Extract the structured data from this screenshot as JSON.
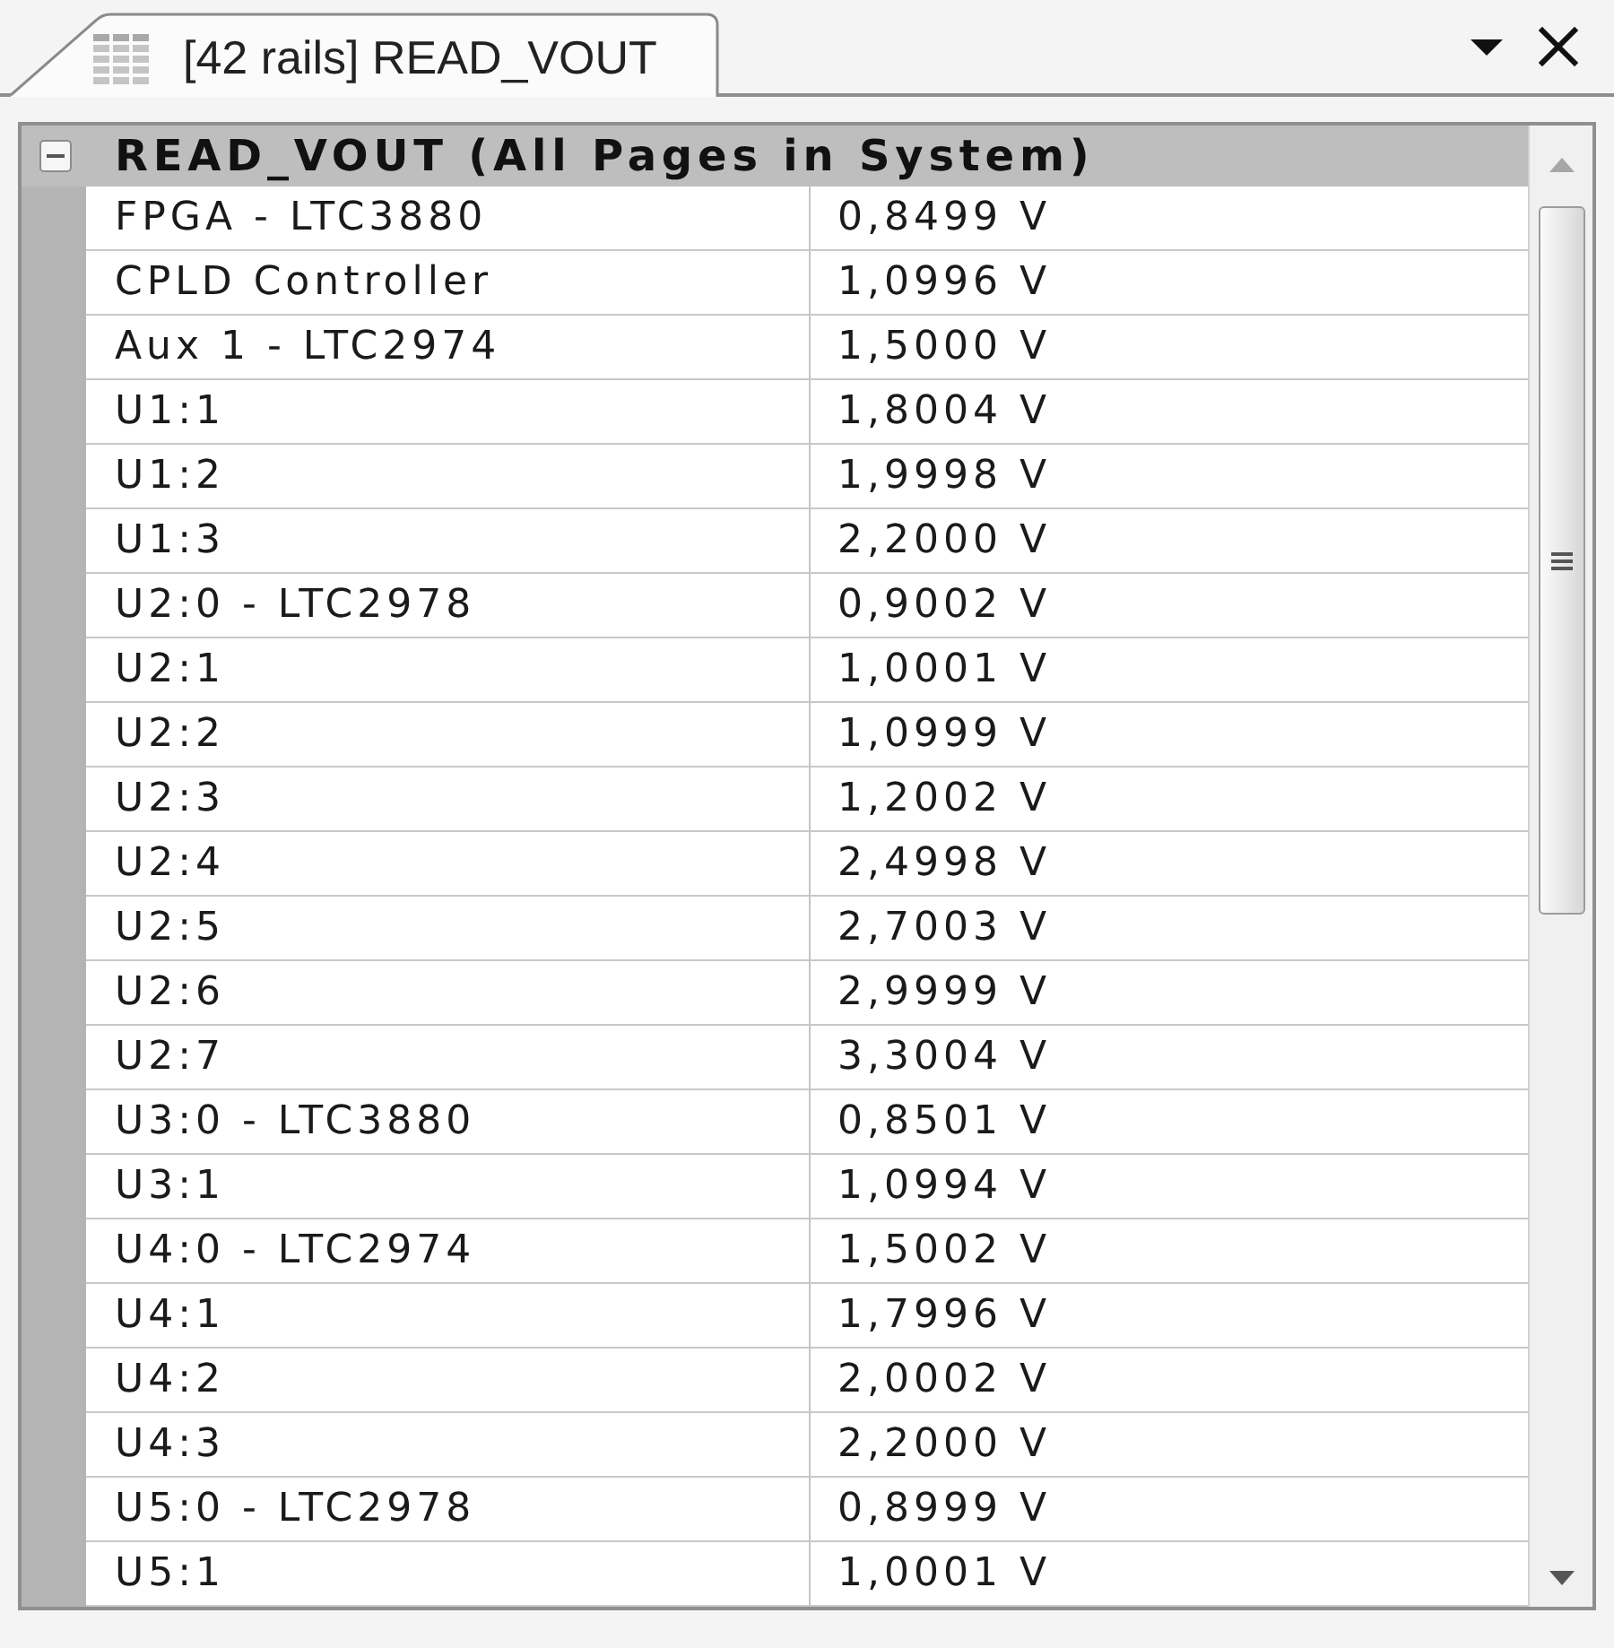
{
  "tab": {
    "label": "[42 rails] READ_VOUT"
  },
  "group": {
    "title": "READ_VOUT (All Pages in System)",
    "expanded": true,
    "rows": [
      {
        "name": "FPGA - LTC3880",
        "value": "0,8499 V"
      },
      {
        "name": "CPLD Controller",
        "value": "1,0996 V"
      },
      {
        "name": "Aux 1 - LTC2974",
        "value": "1,5000 V"
      },
      {
        "name": "U1:1",
        "value": "1,8004 V"
      },
      {
        "name": "U1:2",
        "value": "1,9998 V"
      },
      {
        "name": "U1:3",
        "value": "2,2000 V"
      },
      {
        "name": "U2:0 - LTC2978",
        "value": "0,9002 V"
      },
      {
        "name": "U2:1",
        "value": "1,0001 V"
      },
      {
        "name": "U2:2",
        "value": "1,0999 V"
      },
      {
        "name": "U2:3",
        "value": "1,2002 V"
      },
      {
        "name": "U2:4",
        "value": "2,4998 V"
      },
      {
        "name": "U2:5",
        "value": "2,7003 V"
      },
      {
        "name": "U2:6",
        "value": "2,9999 V"
      },
      {
        "name": "U2:7",
        "value": "3,3004 V"
      },
      {
        "name": "U3:0 - LTC3880",
        "value": "0,8501 V"
      },
      {
        "name": "U3:1",
        "value": "1,0994 V"
      },
      {
        "name": "U4:0 - LTC2974",
        "value": "1,5002 V"
      },
      {
        "name": "U4:1",
        "value": "1,7996 V"
      },
      {
        "name": "U4:2",
        "value": "2,0002 V"
      },
      {
        "name": "U4:3",
        "value": "2,2000 V"
      },
      {
        "name": "U5:0 - LTC2978",
        "value": "0,8999 V"
      },
      {
        "name": "U5:1",
        "value": "1,0001 V"
      }
    ]
  }
}
